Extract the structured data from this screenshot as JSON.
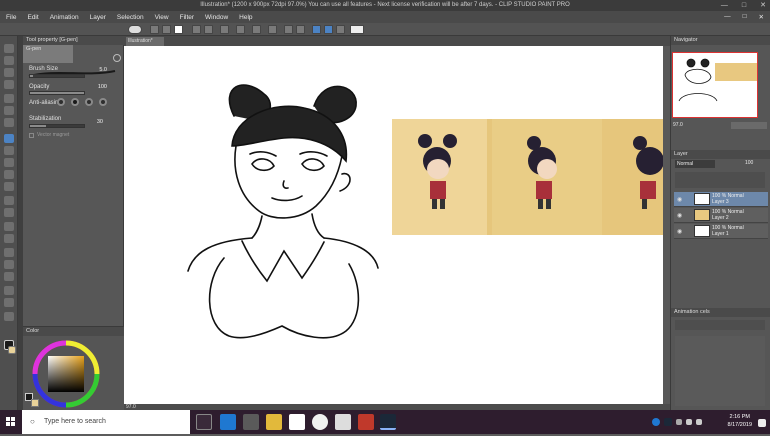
{
  "window": {
    "title": "Illustration* (1200 x 900px 72dpi 97.0%)  You can use all features - Next license verification will be after 7 days. - CLIP STUDIO PAINT PRO",
    "minimize": "—",
    "maximize": "□",
    "close": "✕"
  },
  "menubar": {
    "items": [
      "File",
      "Edit",
      "Animation",
      "Layer",
      "Selection",
      "View",
      "Filter",
      "Window",
      "Help"
    ]
  },
  "tool_property": {
    "tab_label": "Tool property [G-pen]",
    "subtool_name": "G-pen",
    "brush_size_label": "Brush Size",
    "brush_size_value": "5.0",
    "brush_size_fraction": 0.05,
    "opacity_label": "Opacity",
    "opacity_value": "100",
    "opacity_fraction": 1.0,
    "anti_aliasing_label": "Anti-aliasing",
    "stabilization_label": "Stabilization",
    "stabilization_value": "30",
    "stabilization_fraction": 0.3,
    "vector_magnet_label": "Vector magnet"
  },
  "color_panel": {
    "tab_label": "Color",
    "main_color": "#1a1a1a",
    "sub_color": "#ffffff"
  },
  "canvas": {
    "tab_label": "Illustration*",
    "zoom_value": "97.0"
  },
  "navigator": {
    "tab_label": "Navigator",
    "zoom_value": "97.0"
  },
  "layer_panel": {
    "tab_label": "Layer",
    "blend_mode": "Normal",
    "opacity_value": "100",
    "layers": [
      {
        "name": "Layer 3",
        "opacity": "100 %",
        "mode": "Normal",
        "selected": true
      },
      {
        "name": "Layer 2",
        "opacity": "100 %",
        "mode": "Normal",
        "selected": false
      },
      {
        "name": "Layer 1",
        "opacity": "100 %",
        "mode": "Normal",
        "selected": false
      }
    ]
  },
  "animation_panel": {
    "tab_label": "Animation cels"
  },
  "taskbar": {
    "search_placeholder": "Type here to search",
    "time": "2:16 PM",
    "date": "8/17/2019"
  }
}
